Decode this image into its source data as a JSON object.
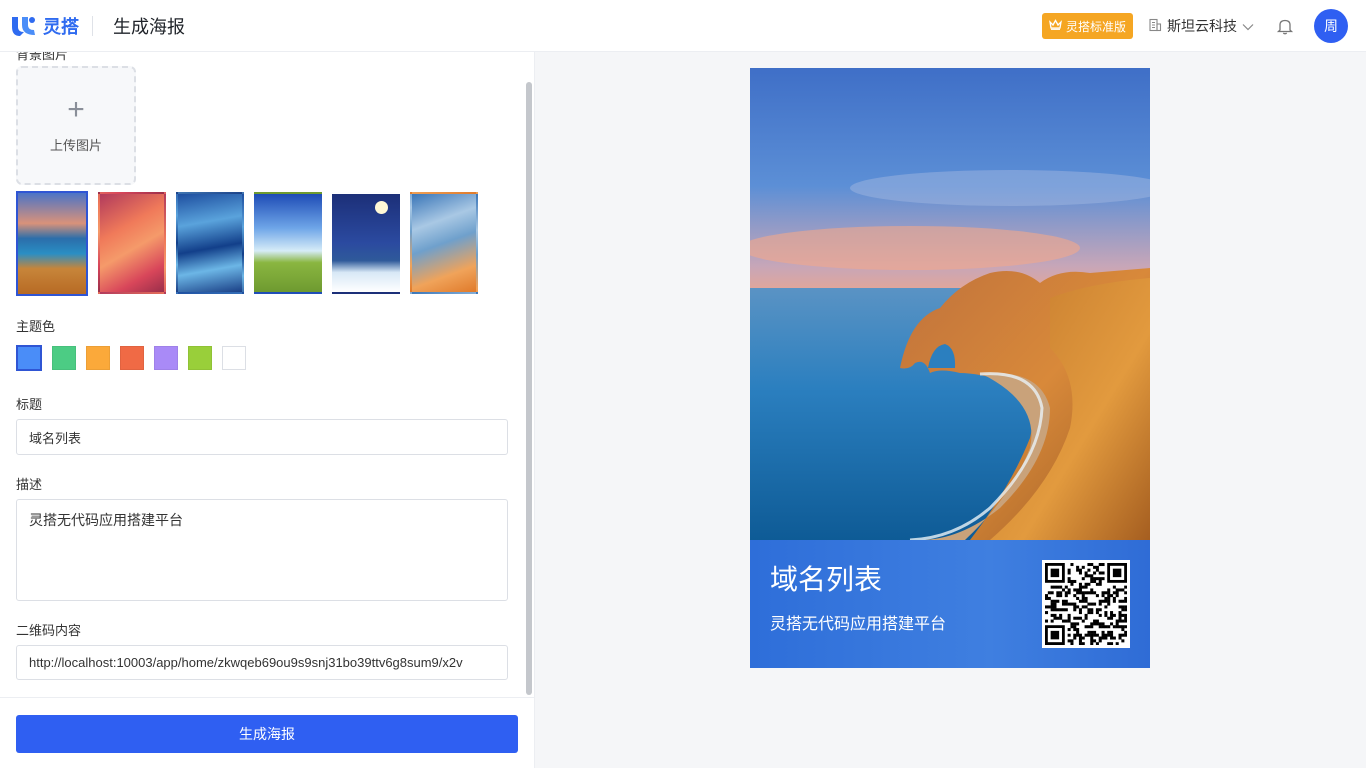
{
  "header": {
    "logo_text": "灵搭",
    "page_title": "生成海报",
    "edition_badge": "灵搭标准版",
    "org_name": "斯坦云科技",
    "avatar_text": "周",
    "brand_color": "#2f6bf0",
    "badge_color": "#f5a623"
  },
  "form": {
    "cut_label": "背景图片",
    "upload_label": "上传图片",
    "backgrounds": [
      "seaside-cliff",
      "red-canyon",
      "ocean-waves",
      "green-field",
      "moon-snow",
      "abstract-paint"
    ],
    "selected_background": 0,
    "theme_label": "主题色",
    "theme_colors": [
      "#4a8df8",
      "#4ccc84",
      "#fba93a",
      "#f06a45",
      "#a98af7",
      "#99cf3a",
      "#ffffff"
    ],
    "selected_theme": 0,
    "title_label": "标题",
    "title_value": "域名列表",
    "desc_label": "描述",
    "desc_value": "灵搭无代码应用搭建平台",
    "qr_label": "二维码内容",
    "qr_value": "http://localhost:10003/app/home/zkwqeb69ou9s9snj31bo39ttv6g8sum9/x2v",
    "generate_label": "生成海报"
  },
  "poster": {
    "title": "域名列表",
    "desc": "灵搭无代码应用搭建平台"
  }
}
